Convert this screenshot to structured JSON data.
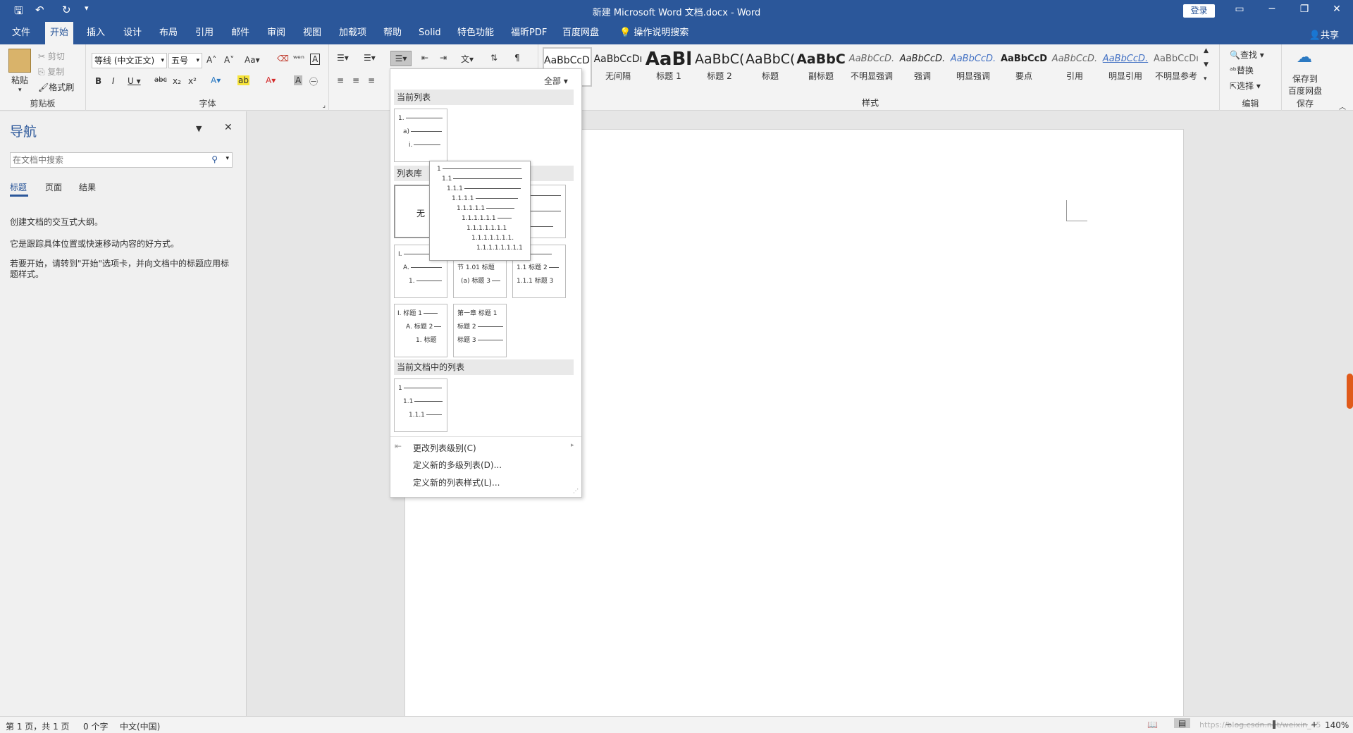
{
  "titlebar": {
    "title": "新建 Microsoft Word 文档.docx  -  Word",
    "login": "登录"
  },
  "tabs": [
    "文件",
    "开始",
    "插入",
    "设计",
    "布局",
    "引用",
    "邮件",
    "审阅",
    "视图",
    "加载项",
    "帮助",
    "Solid",
    "特色功能",
    "福昕PDF",
    "百度网盘",
    "操作说明搜索"
  ],
  "share": "共享",
  "clipboard": {
    "paste": "粘贴",
    "cut": "剪切",
    "copy": "复制",
    "format_painter": "格式刷",
    "label": "剪贴板"
  },
  "font": {
    "name": "等线 (中文正文)",
    "size": "五号",
    "label": "字体"
  },
  "styles": {
    "label": "样式",
    "items": [
      {
        "preview": "AaBbCcDı",
        "name": "正文"
      },
      {
        "preview": "AaBbCcDı",
        "name": "无间隔"
      },
      {
        "preview": "AaBl",
        "name": "标题 1"
      },
      {
        "preview": "AaBbC(",
        "name": "标题 2"
      },
      {
        "preview": "AaBbC(",
        "name": "标题"
      },
      {
        "preview": "AaBbC",
        "name": "副标题"
      },
      {
        "preview": "AaBbCcD.",
        "name": "不明显强调"
      },
      {
        "preview": "AaBbCcD.",
        "name": "强调"
      },
      {
        "preview": "AaBbCcD.",
        "name": "明显强调"
      },
      {
        "preview": "AaBbCcD",
        "name": "要点"
      },
      {
        "preview": "AaBbCcD.",
        "name": "引用"
      },
      {
        "preview": "AaBbCcD.",
        "name": "明显引用"
      },
      {
        "preview": "AaBbCcDı",
        "name": "不明显参考"
      }
    ]
  },
  "editing": {
    "find": "查找",
    "replace": "替换",
    "select": "选择",
    "label": "编辑"
  },
  "save": {
    "line1": "保存到",
    "line2": "百度网盘",
    "label": "保存"
  },
  "nav": {
    "title": "导航",
    "search_placeholder": "在文档中搜索",
    "tabs": [
      "标题",
      "页面",
      "结果"
    ],
    "text1": "创建文档的交互式大纲。",
    "text2": "它是跟踪具体位置或快速移动内容的好方式。",
    "text3": "若要开始，请转到\"开始\"选项卡，并向文档中的标题应用标题样式。"
  },
  "dropdown": {
    "filter": "全部",
    "current_list": "当前列表",
    "list_library": "列表库",
    "none": "无",
    "doc_lists": "当前文档中的列表",
    "change_level": "更改列表级别(C)",
    "define_new_multilevel": "定义新的多级列表(D)...",
    "define_new_style": "定义新的列表样式(L)..."
  },
  "tooltip_lines": [
    "1",
    "1.1",
    "1.1.1",
    "1.1.1.1",
    "1.1.1.1.1",
    "1.1.1.1.1.1",
    "1.1.1.1.1.1.1",
    "1.1.1.1.1.1.1.",
    "1.1.1.1.1.1.1.1"
  ],
  "status": {
    "page": "第 1 页，共 1 页",
    "words": "0 个字",
    "lang": "中文(中国)",
    "zoom": "140%",
    "watermark": "https://blog.csdn.net/weixin_45"
  }
}
